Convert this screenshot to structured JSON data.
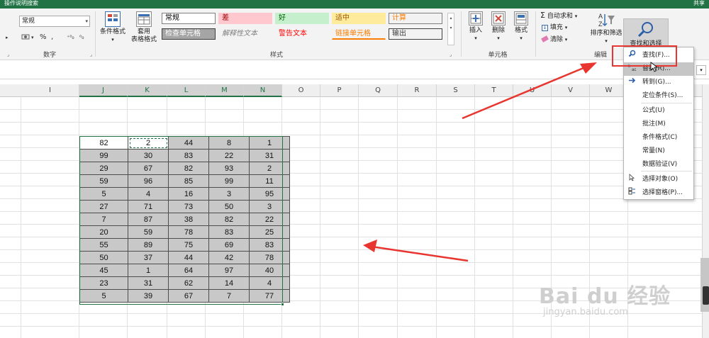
{
  "titlebar": {
    "title": "操作说明搜索",
    "share": "共享"
  },
  "ribbon": {
    "number": {
      "format_value": "常规",
      "group_label": "数字",
      "percent": "%",
      "comma": ",",
      "currency_dropdown": "▾",
      "inc_decimal": "⁺⁰₀",
      "dec_decimal": "⁰₀"
    },
    "styles": {
      "conditional_format": "条件格式",
      "format_as_table_l1": "套用",
      "format_as_table_l2": "表格格式",
      "group_label": "样式",
      "cell_styles": [
        {
          "label": "常规",
          "fg": "#000000",
          "bg": "#ffffff",
          "border": "#7f7f7f"
        },
        {
          "label": "差",
          "fg": "#9c0006",
          "bg": "#ffc7ce",
          "border": "#ffc7ce"
        },
        {
          "label": "好",
          "fg": "#006100",
          "bg": "#c6efce",
          "border": "#c6efce"
        },
        {
          "label": "适中",
          "fg": "#9c5700",
          "bg": "#ffeb9c",
          "border": "#ffeb9c"
        },
        {
          "label": "计算",
          "fg": "#fa7d00",
          "bg": "#f2f2f2",
          "border": "#7f7f7f"
        },
        {
          "label": "检查单元格",
          "fg": "#ffffff",
          "bg": "#a5a5a5",
          "border": "#3f3f3f"
        },
        {
          "label": "解释性文本",
          "fg": "#7f7f7f",
          "bg": "transparent",
          "border": "transparent"
        },
        {
          "label": "警告文本",
          "fg": "#ff0000",
          "bg": "transparent",
          "border": "transparent"
        },
        {
          "label": "链接单元格",
          "fg": "#fa7d00",
          "bg": "transparent",
          "border": "transparent"
        },
        {
          "label": "输出",
          "fg": "#3f3f3f",
          "bg": "#f2f2f2",
          "border": "#3f3f3f"
        }
      ]
    },
    "cells": {
      "insert": "插入",
      "delete": "删除",
      "format": "格式",
      "group_label": "单元格"
    },
    "editing": {
      "autosum": "自动求和",
      "fill": "填充",
      "clear": "清除",
      "sort_filter": "排序和筛选",
      "find_select": "查找和选择",
      "group_label": "编辑"
    }
  },
  "columns": [
    {
      "label": "I",
      "selected": false
    },
    {
      "label": "J",
      "selected": true
    },
    {
      "label": "K",
      "selected": true
    },
    {
      "label": "L",
      "selected": true
    },
    {
      "label": "M",
      "selected": true
    },
    {
      "label": "N",
      "selected": true
    },
    {
      "label": "O",
      "selected": false
    },
    {
      "label": "P",
      "selected": false
    },
    {
      "label": "Q",
      "selected": false
    },
    {
      "label": "R",
      "selected": false
    },
    {
      "label": "S",
      "selected": false
    },
    {
      "label": "T",
      "selected": false
    },
    {
      "label": "U",
      "selected": false
    },
    {
      "label": "V",
      "selected": false
    },
    {
      "label": "W",
      "selected": false
    }
  ],
  "table": [
    [
      82,
      2,
      44,
      8,
      1
    ],
    [
      99,
      30,
      83,
      22,
      31
    ],
    [
      29,
      67,
      82,
      93,
      2
    ],
    [
      59,
      96,
      85,
      99,
      11
    ],
    [
      5,
      4,
      16,
      3,
      95
    ],
    [
      27,
      71,
      73,
      50,
      3
    ],
    [
      7,
      87,
      38,
      82,
      22
    ],
    [
      20,
      59,
      78,
      83,
      25
    ],
    [
      55,
      89,
      75,
      69,
      83
    ],
    [
      50,
      37,
      44,
      42,
      78
    ],
    [
      45,
      1,
      64,
      97,
      40
    ],
    [
      23,
      31,
      62,
      14,
      4
    ],
    [
      5,
      39,
      67,
      7,
      77
    ]
  ],
  "find_menu": {
    "items": [
      {
        "label": "查找(F)...",
        "icon": "search-icon",
        "highlighted": false
      },
      {
        "label": "替换(R)...",
        "icon": "replace-icon",
        "highlighted": true
      },
      {
        "label": "转到(G)...",
        "icon": "arrow-right-icon",
        "highlighted": false
      },
      {
        "label": "定位条件(S)...",
        "icon": "",
        "highlighted": false
      },
      {
        "label": "公式(U)",
        "icon": "",
        "highlighted": false
      },
      {
        "label": "批注(M)",
        "icon": "",
        "highlighted": false
      },
      {
        "label": "条件格式(C)",
        "icon": "",
        "highlighted": false
      },
      {
        "label": "常量(N)",
        "icon": "",
        "highlighted": false
      },
      {
        "label": "数据验证(V)",
        "icon": "",
        "highlighted": false
      },
      {
        "label": "选择对象(O)",
        "icon": "cursor-icon",
        "highlighted": false
      },
      {
        "label": "选择窗格(P)...",
        "icon": "pane-icon",
        "highlighted": false
      }
    ]
  },
  "watermark": {
    "text": "Bai du 经验",
    "url": "jingyan.baidu.com"
  },
  "colors": {
    "accent": "#217346",
    "annotation_red": "#e8352f"
  }
}
